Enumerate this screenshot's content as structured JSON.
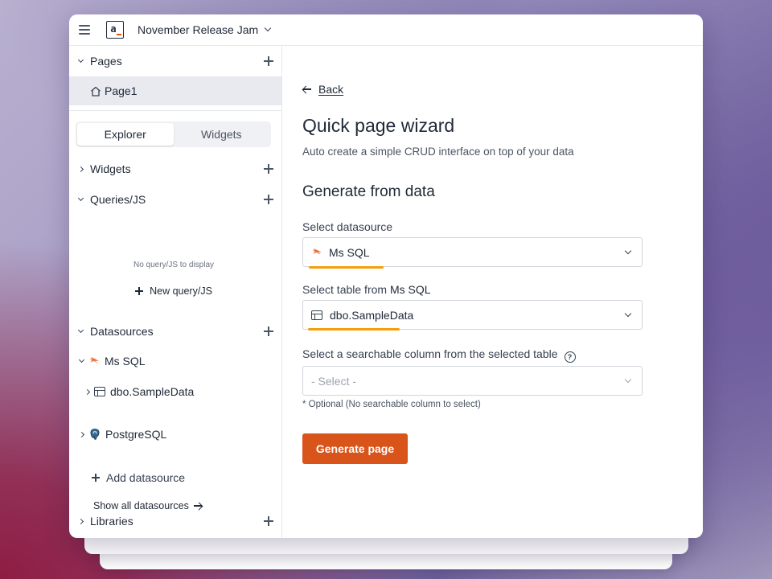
{
  "app": {
    "name": "November Release Jam"
  },
  "sidebar": {
    "pages_label": "Pages",
    "page_item": "Page1",
    "tabs": [
      {
        "label": "Explorer",
        "active": true
      },
      {
        "label": "Widgets",
        "active": false
      }
    ],
    "widgets_label": "Widgets",
    "queries_label": "Queries/JS",
    "empty_queries": "No query/JS to display",
    "new_query": "New query/JS",
    "datasources_label": "Datasources",
    "datasources": [
      {
        "name": "Ms SQL",
        "icon": "mssql-icon",
        "expanded": true,
        "tables": [
          "dbo.SampleData"
        ]
      },
      {
        "name": "PostgreSQL",
        "icon": "postgresql-icon",
        "expanded": false
      }
    ],
    "add_datasource": "Add datasource",
    "show_all": "Show all datasources",
    "libraries_label": "Libraries"
  },
  "main": {
    "back": "Back",
    "title": "Quick page wizard",
    "subtitle": "Auto create a simple CRUD interface on top of your data",
    "section": "Generate from data",
    "datasource_label": "Select datasource",
    "datasource_value": "Ms SQL",
    "table_label_prefix": "Select table from ",
    "table_label_ds": "Ms SQL",
    "table_value": "dbo.SampleData",
    "column_label": "Select a searchable column from the selected table",
    "column_placeholder": "- Select -",
    "column_hint": "* Optional (No searchable column to select)",
    "generate_button": "Generate page"
  },
  "colors": {
    "accent": "#d9541a",
    "highlight": "#f59e0b",
    "selected_bg": "#e8eaf0"
  }
}
